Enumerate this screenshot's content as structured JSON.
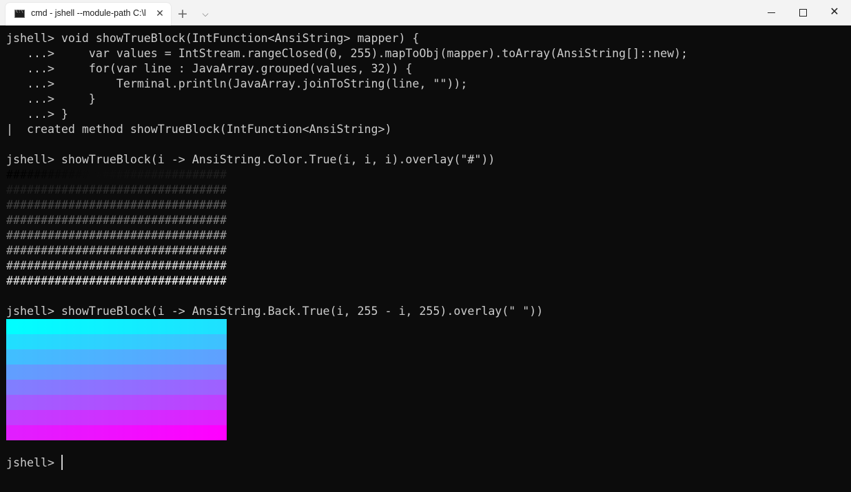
{
  "window": {
    "tab_title": "cmd - jshell  --module-path C:\\l",
    "tab_icon": "cmd-icon",
    "close_tab_glyph": "✕",
    "new_tab_glyph": "+",
    "dropdown_glyph": "⌵",
    "close_glyph": "✕"
  },
  "terminal": {
    "lines": [
      "jshell> void showTrueBlock(IntFunction<AnsiString> mapper) {",
      "   ...>     var values = IntStream.rangeClosed(0, 255).mapToObj(mapper).toArray(AnsiString[]::new);",
      "   ...>     for(var line : JavaArray.grouped(values, 32)) {",
      "   ...>         Terminal.println(JavaArray.joinToString(line, \"\"));",
      "   ...>     }",
      "   ...> }",
      "|  created method showTrueBlock(IntFunction<AnsiString>)",
      "",
      "jshell> showTrueBlock(i -> AnsiString.Color.True(i, i, i).overlay(\"#\"))",
      "################################",
      "################################",
      "################################",
      "################################",
      "################################",
      "################################",
      "################################",
      "################################",
      "",
      "jshell> showTrueBlock(i -> AnsiString.Back.True(i, 255 - i, 255).overlay(\" \"))"
    ],
    "gradient_rows": 8,
    "prompt": "jshell> "
  },
  "colors": {
    "background": "#0c0c0c",
    "foreground": "#cccccc"
  }
}
